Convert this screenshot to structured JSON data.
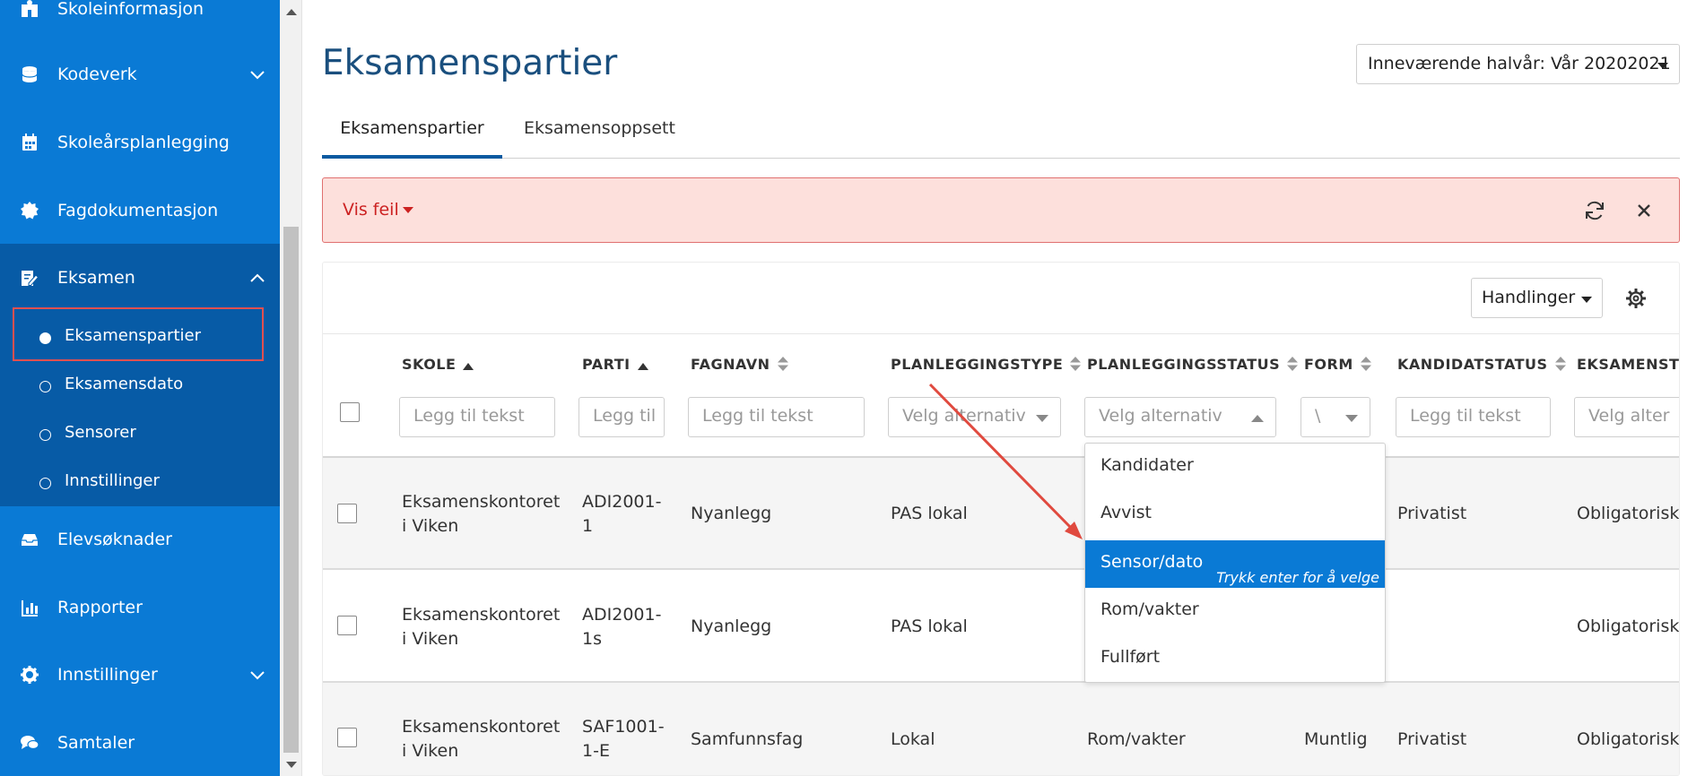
{
  "sidebar": {
    "items": [
      {
        "label": "Skoleinformasjon",
        "icon": "school-icon"
      },
      {
        "label": "Kodeverk",
        "icon": "database-icon"
      },
      {
        "label": "Skoleårsplanlegging",
        "icon": "calendar-icon"
      },
      {
        "label": "Fagdokumentasjon",
        "icon": "badge-icon"
      },
      {
        "label": "Eksamen",
        "icon": "edit-document-icon"
      },
      {
        "label": "Elevsøknader",
        "icon": "inbox-icon"
      },
      {
        "label": "Rapporter",
        "icon": "bar-chart-icon"
      },
      {
        "label": "Innstillinger",
        "icon": "gear-icon"
      },
      {
        "label": "Samtaler",
        "icon": "chat-icon"
      }
    ],
    "eksamen_sub": [
      {
        "label": "Eksamenspartier",
        "active": true
      },
      {
        "label": "Eksamensdato"
      },
      {
        "label": "Sensorer"
      },
      {
        "label": "Innstillinger"
      }
    ]
  },
  "header": {
    "title": "Eksamenspartier",
    "semester_label": "Inneværende halvår: Vår 20202021"
  },
  "tabs": [
    {
      "label": "Eksamenspartier",
      "active": true
    },
    {
      "label": "Eksamensoppsett"
    }
  ],
  "error_bar": {
    "toggle_label": "Vis feil"
  },
  "toolbar": {
    "actions_label": "Handlinger"
  },
  "table": {
    "columns": [
      {
        "label": "SKOLE",
        "sort": "asc"
      },
      {
        "label": "PARTI",
        "sort": "asc"
      },
      {
        "label": "FAGNAVN",
        "sort": "none"
      },
      {
        "label": "PLANLEGGINGSTYPE",
        "sort": "none"
      },
      {
        "label": "PLANLEGGINGSSTATUS",
        "sort": "none"
      },
      {
        "label": "FORM",
        "sort": "none"
      },
      {
        "label": "KANDIDATSTATUS",
        "sort": "none"
      },
      {
        "label": "EKSAMENSTYP"
      }
    ],
    "filters": {
      "skole": "Legg til tekst",
      "parti": "Legg til",
      "fagnavn": "Legg til tekst",
      "planleggingstype": "Velg alternativ",
      "planleggingsstatus": "Velg alternativ",
      "form": "\\",
      "kandidatstatus": "Legg til tekst",
      "eksamenstype": "Velg alter"
    },
    "rows": [
      {
        "skole": [
          "Eksamenskontoret",
          "i Viken"
        ],
        "parti": [
          "ADI2001-",
          "1"
        ],
        "fagnavn": "Nyanlegg",
        "planleggingstype": "PAS lokal",
        "planleggingsstatus": "",
        "form": "",
        "kandidatstatus": "Privatist",
        "eksamenstype": "Obligatorisk"
      },
      {
        "skole": [
          "Eksamenskontoret",
          "i Viken"
        ],
        "parti": [
          "ADI2001-",
          "1s"
        ],
        "fagnavn": "Nyanlegg",
        "planleggingstype": "PAS lokal",
        "planleggingsstatus": "",
        "form": "",
        "kandidatstatus": "",
        "eksamenstype": "Obligatorisk"
      },
      {
        "skole": [
          "Eksamenskontoret",
          "i Viken"
        ],
        "parti": [
          "SAF1001-",
          "1-E"
        ],
        "fagnavn": "Samfunnsfag",
        "planleggingstype": "Lokal",
        "planleggingsstatus": "Rom/vakter",
        "form": "Muntlig",
        "kandidatstatus": "Privatist",
        "eksamenstype": "Obligatorisk"
      }
    ]
  },
  "dropdown": {
    "options": [
      "Kandidater",
      "Avvist",
      "Sensor/dato",
      "Rom/vakter",
      "Fullført"
    ],
    "selected_index": 2,
    "hint": "Trykk enter for å velge"
  },
  "colors": {
    "sidebar_bg": "#0a7ad5",
    "sidebar_group_bg": "#075ba6",
    "error_bg": "#fde0dc",
    "error_text": "#cc2222",
    "accent": "#0a5aa0"
  }
}
